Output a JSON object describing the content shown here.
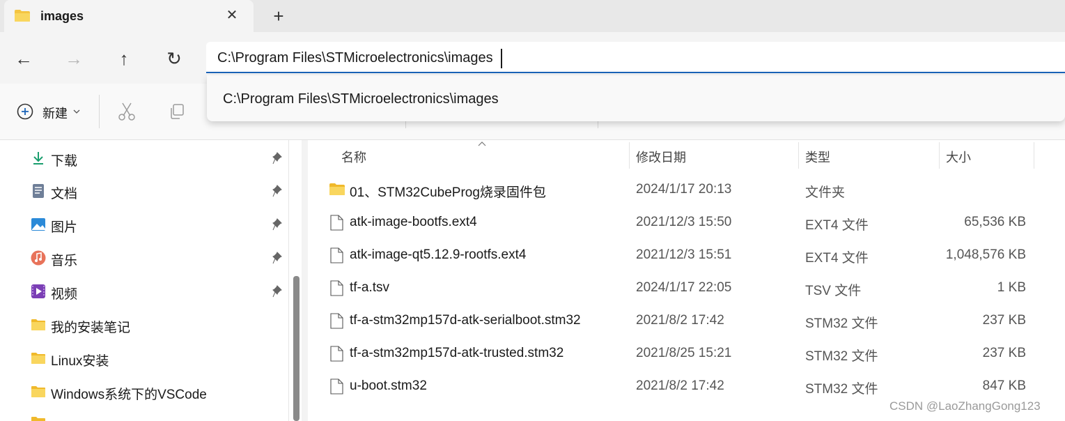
{
  "tab": {
    "title": "images",
    "close": "✕",
    "new_tab": "+"
  },
  "nav": {
    "back": "←",
    "forward": "→",
    "up": "↑",
    "refresh": "↻"
  },
  "address": {
    "value": "C:\\Program Files\\STMicroelectronics\\images",
    "suggestion": "C:\\Program Files\\STMicroelectronics\\images"
  },
  "toolbar": {
    "new_label": "新建"
  },
  "sidebar": {
    "items": [
      {
        "label": "下载",
        "icon": "download-icon",
        "pinned": true
      },
      {
        "label": "文档",
        "icon": "document-icon",
        "pinned": true
      },
      {
        "label": "图片",
        "icon": "pictures-icon",
        "pinned": true
      },
      {
        "label": "音乐",
        "icon": "music-icon",
        "pinned": true
      },
      {
        "label": "视频",
        "icon": "video-icon",
        "pinned": true
      },
      {
        "label": "我的安装笔记",
        "icon": "folder-icon",
        "pinned": false
      },
      {
        "label": "Linux安装",
        "icon": "folder-icon",
        "pinned": false
      },
      {
        "label": "Windows系统下的VSCode",
        "icon": "folder-icon",
        "pinned": false
      }
    ]
  },
  "columns": {
    "name": "名称",
    "date": "修改日期",
    "type": "类型",
    "size": "大小"
  },
  "files": [
    {
      "name": "01、STM32CubeProg烧录固件包",
      "date": "2024/1/17 20:13",
      "type": "文件夹",
      "size": "",
      "kind": "folder"
    },
    {
      "name": "atk-image-bootfs.ext4",
      "date": "2021/12/3 15:50",
      "type": "EXT4 文件",
      "size": "65,536 KB",
      "kind": "file"
    },
    {
      "name": "atk-image-qt5.12.9-rootfs.ext4",
      "date": "2021/12/3 15:51",
      "type": "EXT4 文件",
      "size": "1,048,576 KB",
      "kind": "file"
    },
    {
      "name": "tf-a.tsv",
      "date": "2024/1/17 22:05",
      "type": "TSV 文件",
      "size": "1 KB",
      "kind": "file"
    },
    {
      "name": "tf-a-stm32mp157d-atk-serialboot.stm32",
      "date": "2021/8/2 17:42",
      "type": "STM32 文件",
      "size": "237 KB",
      "kind": "file"
    },
    {
      "name": "tf-a-stm32mp157d-atk-trusted.stm32",
      "date": "2021/8/25 15:21",
      "type": "STM32 文件",
      "size": "237 KB",
      "kind": "file"
    },
    {
      "name": "u-boot.stm32",
      "date": "2021/8/2 17:42",
      "type": "STM32 文件",
      "size": "847 KB",
      "kind": "file"
    }
  ],
  "watermark": "CSDN @LaoZhangGong123",
  "colors": {
    "accent": "#1a63b8",
    "folder": "#f4c542"
  }
}
